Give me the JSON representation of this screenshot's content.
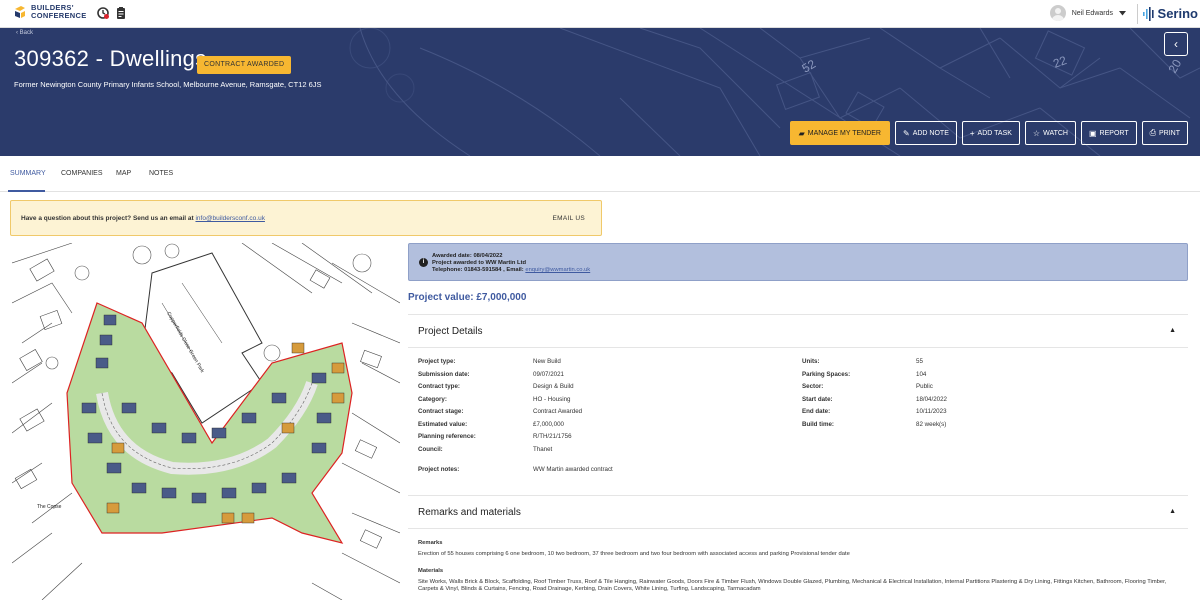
{
  "topbar": {
    "logo_line1": "BUILDERS'",
    "logo_line2": "CONFERENCE",
    "user_name": "Neil Edwards",
    "brand": "Serino"
  },
  "hero": {
    "back_label": "‹ Back",
    "title": "309362 - Dwellings",
    "status": "CONTRACT AWARDED",
    "address": "Former Newington County Primary Infants School, Melbourne Avenue, Ramsgate, CT12 6JS",
    "collapse_label": "‹",
    "actions": {
      "manage": "MANAGE MY TENDER",
      "add_note": "ADD NOTE",
      "add_task": "ADD TASK",
      "watch": "WATCH",
      "report": "REPORT",
      "print": "PRINT"
    },
    "map_plot_labels": [
      "52",
      "22",
      "20"
    ]
  },
  "tabs": [
    "SUMMARY",
    "COMPANIES",
    "MAP",
    "NOTES"
  ],
  "question": {
    "text": "Have a question about this project? Send us an email at",
    "email": "info@buildersconf.co.uk",
    "button": "EMAIL US"
  },
  "site_plan": {
    "label_copse": "The Copse",
    "label_street": "Copperfields Close Green Park"
  },
  "award": {
    "date_line": "Awarded date: 08/04/2022",
    "awarded_to": "Project awarded to WW Martin Ltd",
    "telephone": "Telephone: 01843-591584 , Email:",
    "email": "enquiry@wwmartin.co.uk"
  },
  "project_value": "Project value: £7,000,000",
  "project_details": {
    "heading": "Project Details",
    "left": [
      {
        "label": "Project type:",
        "value": "New Build"
      },
      {
        "label": "Submission date:",
        "value": "09/07/2021"
      },
      {
        "label": "Contract type:",
        "value": "Design & Build"
      },
      {
        "label": "Category:",
        "value": "HO - Housing"
      },
      {
        "label": "Contract stage:",
        "value": "Contract Awarded"
      },
      {
        "label": "Estimated value:",
        "value": "£7,000,000"
      },
      {
        "label": "Planning reference:",
        "value": "R/TH/21/1756"
      },
      {
        "label": "Council:",
        "value": "Thanet"
      }
    ],
    "notes_label": "Project notes:",
    "notes_value": "WW Martin awarded contract",
    "right": [
      {
        "label": "Units:",
        "value": "55"
      },
      {
        "label": "Parking Spaces:",
        "value": "104"
      },
      {
        "label": "Sector:",
        "value": "Public"
      },
      {
        "label": "Start date:",
        "value": "18/04/2022"
      },
      {
        "label": "End date:",
        "value": "10/11/2023"
      },
      {
        "label": "Build time:",
        "value": "82 week(s)"
      }
    ]
  },
  "remarks": {
    "heading": "Remarks and materials",
    "remarks_label": "Remarks",
    "remarks_text": "Erection of 55 houses comprising 6 one bedroom, 10 two bedroom, 37 three bedroom and two four bedroom with associated access and parking Provisional tender date",
    "materials_label": "Materials",
    "materials_text": "Site Works, Walls Brick & Block, Scaffolding, Roof Timber Truss, Roof & Tile Hanging, Rainwater Goods, Doors Fire & Timber Flush, Windows Double Glazed, Plumbing, Mechanical & Electrical Installation, Internal Partitions Plastering & Dry Lining, Fittings Kitchen, Bathroom, Flooring Timber, Carpets & Vinyl, Blinds & Curtains, Fencing, Road Drainage, Kerbing, Drain Covers, White Lining, Turfing, Landscaping, Tarmacadam"
  },
  "colors": {
    "navy": "#2b3b6b",
    "accent_blue": "#3f5aa0",
    "amber": "#f7b731"
  }
}
